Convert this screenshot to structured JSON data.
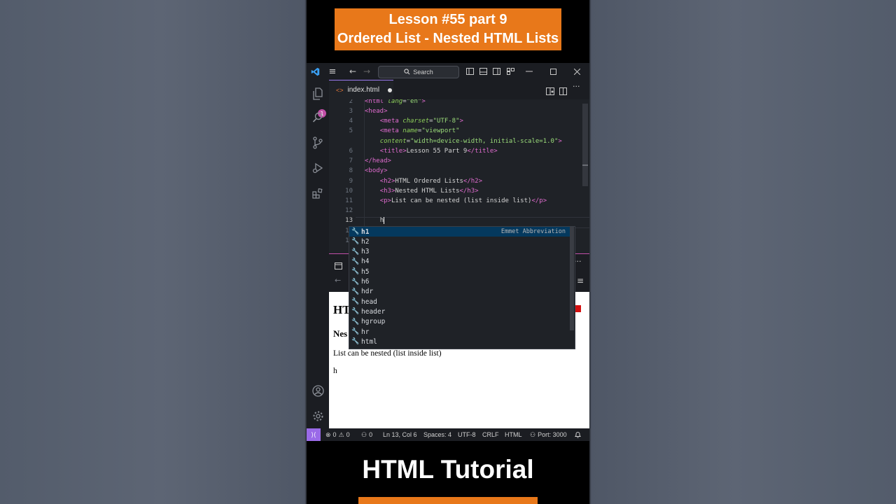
{
  "banner": {
    "line1": "Lesson #55 part 9",
    "line2": "Ordered List - Nested HTML Lists"
  },
  "titlebar": {
    "search": "Search"
  },
  "activity": {
    "badge": "1"
  },
  "tab": {
    "filename": "index.html"
  },
  "code": {
    "lines": [
      {
        "n": "2"
      },
      {
        "n": "3"
      },
      {
        "n": "4"
      },
      {
        "n": "5"
      },
      {
        "n": ""
      },
      {
        "n": "6"
      },
      {
        "n": "7"
      },
      {
        "n": "8"
      },
      {
        "n": "9"
      },
      {
        "n": "10"
      },
      {
        "n": "11"
      },
      {
        "n": "12"
      },
      {
        "n": "13"
      },
      {
        "n": "14"
      },
      {
        "n": "15"
      }
    ],
    "html_open": "<html",
    "lang_attr": "lang",
    "lang_val": "\"en\"",
    "head_open": "<head>",
    "meta1_tag": "<meta",
    "charset_attr": "charset",
    "charset_val": "\"UTF-8\"",
    "meta2_tag": "<meta",
    "name_attr": "name",
    "name_val": "\"viewport\"",
    "content_attr": "content",
    "content_val": "\"width=device-width, initial-scale=1.0\"",
    "title_open": "<title>",
    "title_text": "Lesson 55 Part 9",
    "title_close": "</title>",
    "head_close": "</head>",
    "body_open": "<body>",
    "h2_open": "<h2>",
    "h2_text": "HTML Ordered Lists",
    "h2_close": "</h2>",
    "h3_open": "<h3>",
    "h3_text": "Nested HTML Lists",
    "h3_close": "</h3>",
    "p_open": "<p>",
    "p_text": "List can be nested (list inside list)",
    "p_close": "</p>",
    "typed": "h"
  },
  "suggestions": {
    "detail": "Emmet Abbreviation",
    "items": [
      "h1",
      "h2",
      "h3",
      "h4",
      "h5",
      "h6",
      "hdr",
      "head",
      "header",
      "hgroup",
      "hr",
      "html"
    ]
  },
  "preview": {
    "h2_partial": "HT",
    "h3_partial": "Nes",
    "p": "List can be nested (list inside list)",
    "typed": "h"
  },
  "status": {
    "errors": "0",
    "warnings": "0",
    "ports": "0",
    "position": "Ln 13, Col 6",
    "spaces": "Spaces: 4",
    "encoding": "UTF-8",
    "eol": "CRLF",
    "language": "HTML",
    "port": "Port: 3000"
  },
  "footer": {
    "title": "HTML Tutorial"
  },
  "colors": {
    "accent": "#e8781a",
    "keyword": "#e06ccf",
    "attribute": "#8fd15b"
  }
}
